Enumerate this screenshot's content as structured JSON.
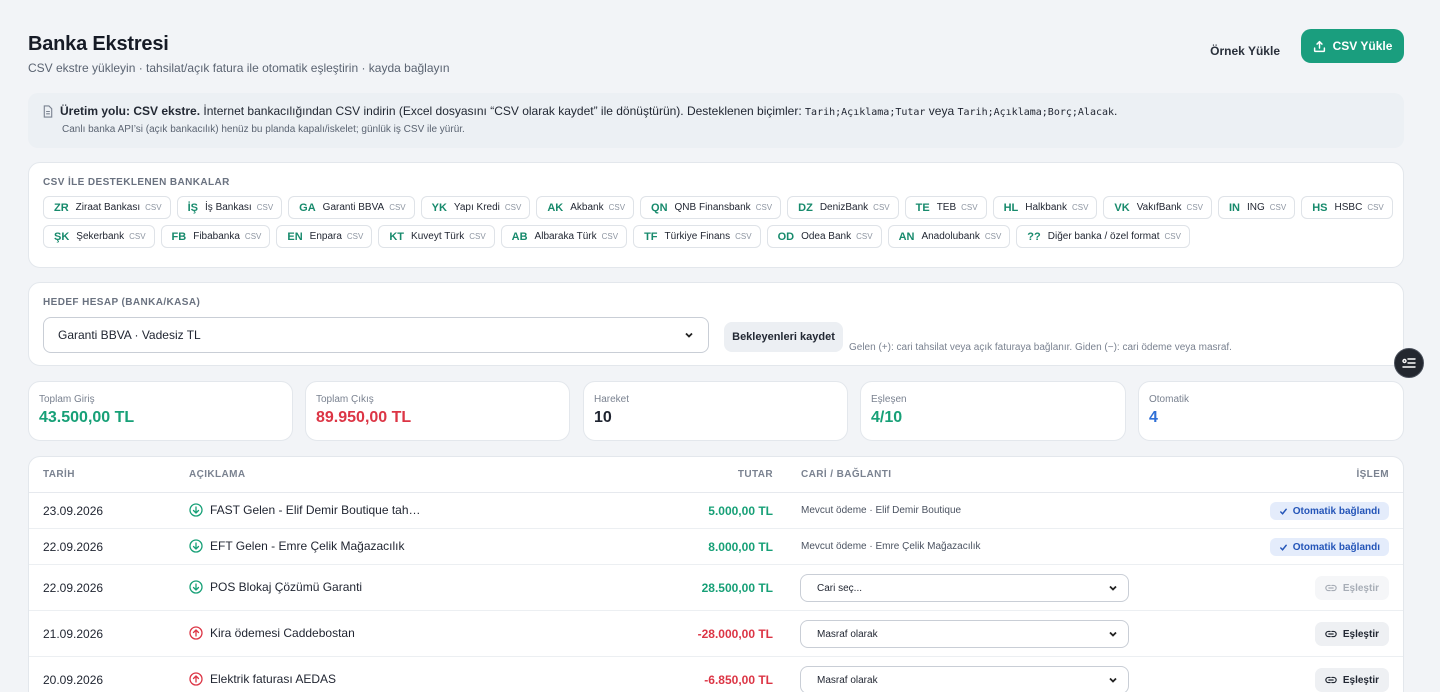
{
  "header": {
    "title": "Banka Ekstresi",
    "subtitle": "CSV ekstre yükleyin · tahsilat/açık fatura ile otomatik eşleştirin · kayda bağlayın",
    "sample_button": "Örnek Yükle",
    "upload_button": "CSV Yükle"
  },
  "notice": {
    "bold": "Üretim yolu: CSV ekstre.",
    "text": "İnternet bankacılığından CSV indirin (Excel dosyasını “CSV olarak kaydet” ile dönüştürün). Desteklenen biçimler:",
    "format1": "Tarih;Açıklama;Tutar",
    "or": "veya",
    "format2": "Tarih;Açıklama;Borç;Alacak",
    "end": ".",
    "note": "Canlı banka API’si (açık bankacılık) henüz bu planda kapalı/iskelet; günlük iş CSV ile yürür."
  },
  "banks": {
    "label": "CSV İLE DESTEKLENEN BANKALAR",
    "tag": "CSV",
    "items": [
      {
        "abbr": "ZR",
        "name": "Ziraat Bankası"
      },
      {
        "abbr": "İŞ",
        "name": "İş Bankası"
      },
      {
        "abbr": "GA",
        "name": "Garanti BBVA"
      },
      {
        "abbr": "YK",
        "name": "Yapı Kredi"
      },
      {
        "abbr": "AK",
        "name": "Akbank"
      },
      {
        "abbr": "QN",
        "name": "QNB Finansbank"
      },
      {
        "abbr": "DZ",
        "name": "DenizBank"
      },
      {
        "abbr": "TE",
        "name": "TEB"
      },
      {
        "abbr": "HL",
        "name": "Halkbank"
      },
      {
        "abbr": "VK",
        "name": "VakıfBank"
      },
      {
        "abbr": "IN",
        "name": "ING"
      },
      {
        "abbr": "HS",
        "name": "HSBC"
      },
      {
        "abbr": "ŞK",
        "name": "Şekerbank"
      },
      {
        "abbr": "FB",
        "name": "Fibabanka"
      },
      {
        "abbr": "EN",
        "name": "Enpara"
      },
      {
        "abbr": "KT",
        "name": "Kuveyt Türk"
      },
      {
        "abbr": "AB",
        "name": "Albaraka Türk"
      },
      {
        "abbr": "TF",
        "name": "Türkiye Finans"
      },
      {
        "abbr": "OD",
        "name": "Odea Bank"
      },
      {
        "abbr": "AN",
        "name": "Anadolubank"
      },
      {
        "abbr": "??",
        "name": "Diğer banka / özel format"
      }
    ]
  },
  "target": {
    "label": "HEDEF HESAP (BANKA/KASA)",
    "selected": "Garanti BBVA · Vadesiz TL",
    "save_button": "Bekleyenleri kaydet",
    "hint": "Gelen (+): cari tahsilat veya açık faturaya bağlanır. Giden (−): cari ödeme veya masraf."
  },
  "stats": [
    {
      "label": "Toplam Giriş",
      "value": "43.500,00 TL",
      "color": "#17a077"
    },
    {
      "label": "Toplam Çıkış",
      "value": "89.950,00 TL",
      "color": "#dc3545"
    },
    {
      "label": "Hareket",
      "value": "10",
      "color": "#1f2430"
    },
    {
      "label": "Eşleşen",
      "value": "4/10",
      "color": "#17a077"
    },
    {
      "label": "Otomatik",
      "value": "4",
      "color": "#2f6fd6"
    }
  ],
  "table": {
    "headers": {
      "date": "TARİH",
      "desc": "AÇIKLAMA",
      "amount": "TUTAR",
      "cari": "CARİ / BAĞLANTI",
      "action": "İŞLEM"
    },
    "rows": [
      {
        "date": "23.09.2026",
        "desc": "FAST Gelen - Elif Demir Boutique tah…",
        "dir": "in",
        "amount": "5.000,00 TL",
        "cari": "Mevcut ödeme · Elif Demir Boutique",
        "action": "Otomatik bağlandı"
      },
      {
        "date": "22.09.2026",
        "desc": "EFT Gelen - Emre Çelik Mağazacılık",
        "dir": "in",
        "amount": "8.000,00 TL",
        "cari": "Mevcut ödeme · Emre Çelik Mağazacılık",
        "action": "Otomatik bağlandı"
      },
      {
        "date": "22.09.2026",
        "desc": "POS Blokaj Çözümü Garanti",
        "dir": "in",
        "amount": "28.500,00 TL",
        "select": "Cari seç...",
        "action": "Eşleştir",
        "disabled": true
      },
      {
        "date": "21.09.2026",
        "desc": "Kira ödemesi Caddebostan",
        "dir": "out",
        "amount": "-28.000,00 TL",
        "select": "Masraf olarak",
        "action": "Eşleştir"
      },
      {
        "date": "20.09.2026",
        "desc": "Elektrik faturası AEDAS",
        "dir": "out",
        "amount": "-6.850,00 TL",
        "select": "Masraf olarak",
        "action": "Eşleştir"
      }
    ]
  }
}
